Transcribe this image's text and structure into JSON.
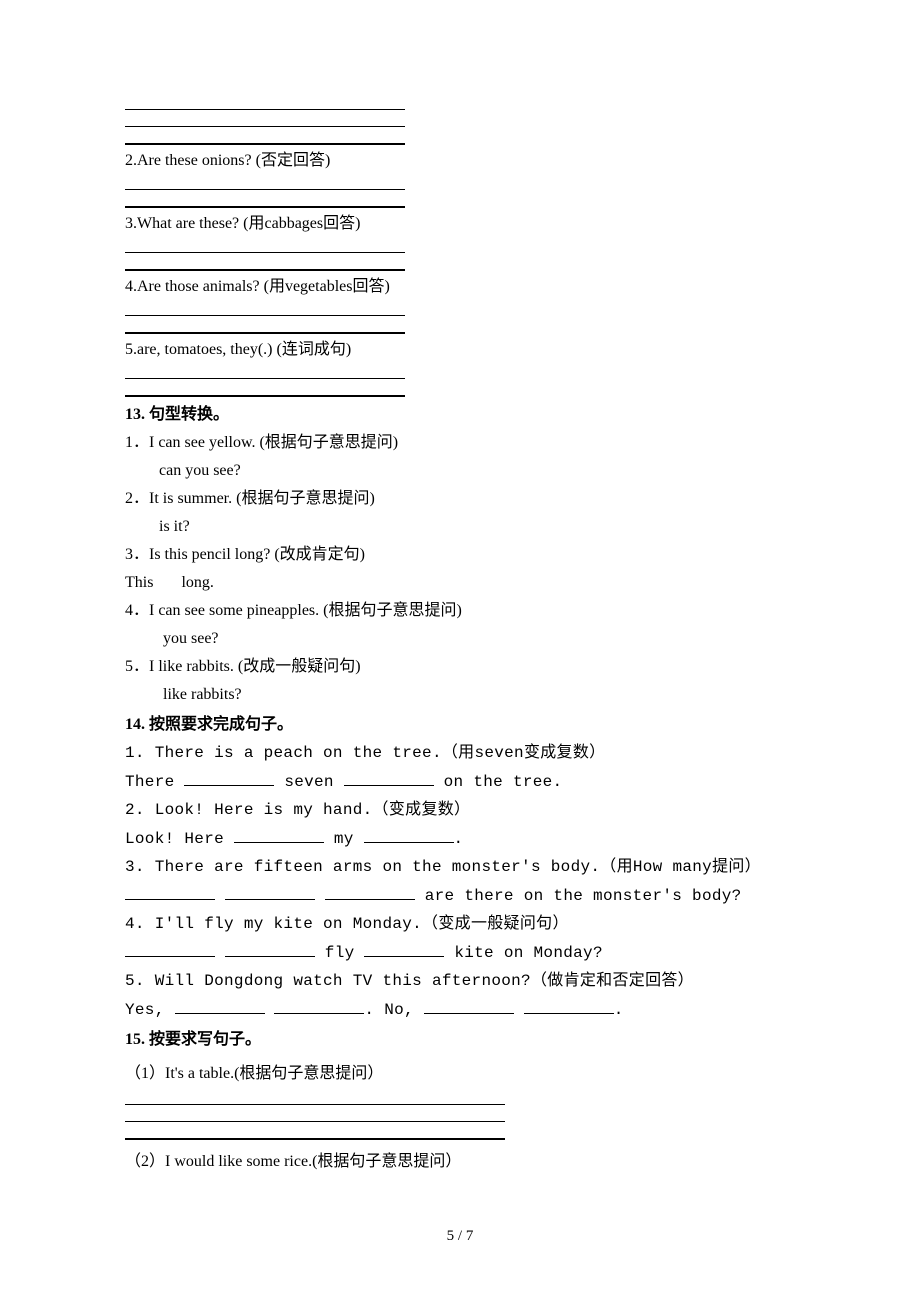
{
  "q2": "2.Are these onions? (否定回答)",
  "q3": "3.What are these? (用cabbages回答)",
  "q4": "4.Are those animals? (用vegetables回答)",
  "q5": "5.are, tomatoes, they(.) (连词成句)",
  "s13": {
    "title": "13. 句型转换。",
    "i1a": "1．I can see yellow. (根据句子意思提问)",
    "i1b": "    can you see?",
    "i2a": "2．It is summer. (根据句子意思提问)",
    "i2b": "    is it?",
    "i3a": "3．Is this pencil long? (改成肯定句)",
    "i3b": "This       long.",
    "i4a": "4．I can see some pineapples. (根据句子意思提问)",
    "i4b": "     you see?",
    "i5a": "5．I like rabbits. (改成一般疑问句)",
    "i5b": "     like rabbits?"
  },
  "s14": {
    "title": "14.  按照要求完成句子。",
    "i1a": "1. There is a peach on the tree.（用seven变成复数）",
    "i1b_pre": "There ",
    "i1b_mid1": " seven ",
    "i1b_post": " on the tree.",
    "i2a": "2. Look! Here is my hand.（变成复数）",
    "i2b_pre": "Look! Here ",
    "i2b_mid": " my ",
    "i2b_post": ".",
    "i3a": "3. There are fifteen arms on the monster's body.（用How many提问）",
    "i3b_post": " are there on the monster's body?",
    "i4a": "4. I'll fly my kite on Monday.（变成一般疑问句）",
    "i4b_mid1": " fly ",
    "i4b_post": " kite on Monday?",
    "i5a": "5. Will Dongdong watch TV this afternoon?（做肯定和否定回答）",
    "i5b_pre": "Yes, ",
    "i5b_mid": ". No, ",
    "i5b_post": "."
  },
  "s15": {
    "title": "15. 按要求写句子。",
    "i1": "（1）It's a table.(根据句子意思提问）",
    "i2": "（2）I would like some rice.(根据句子意思提问）"
  },
  "page_num": "5 / 7"
}
